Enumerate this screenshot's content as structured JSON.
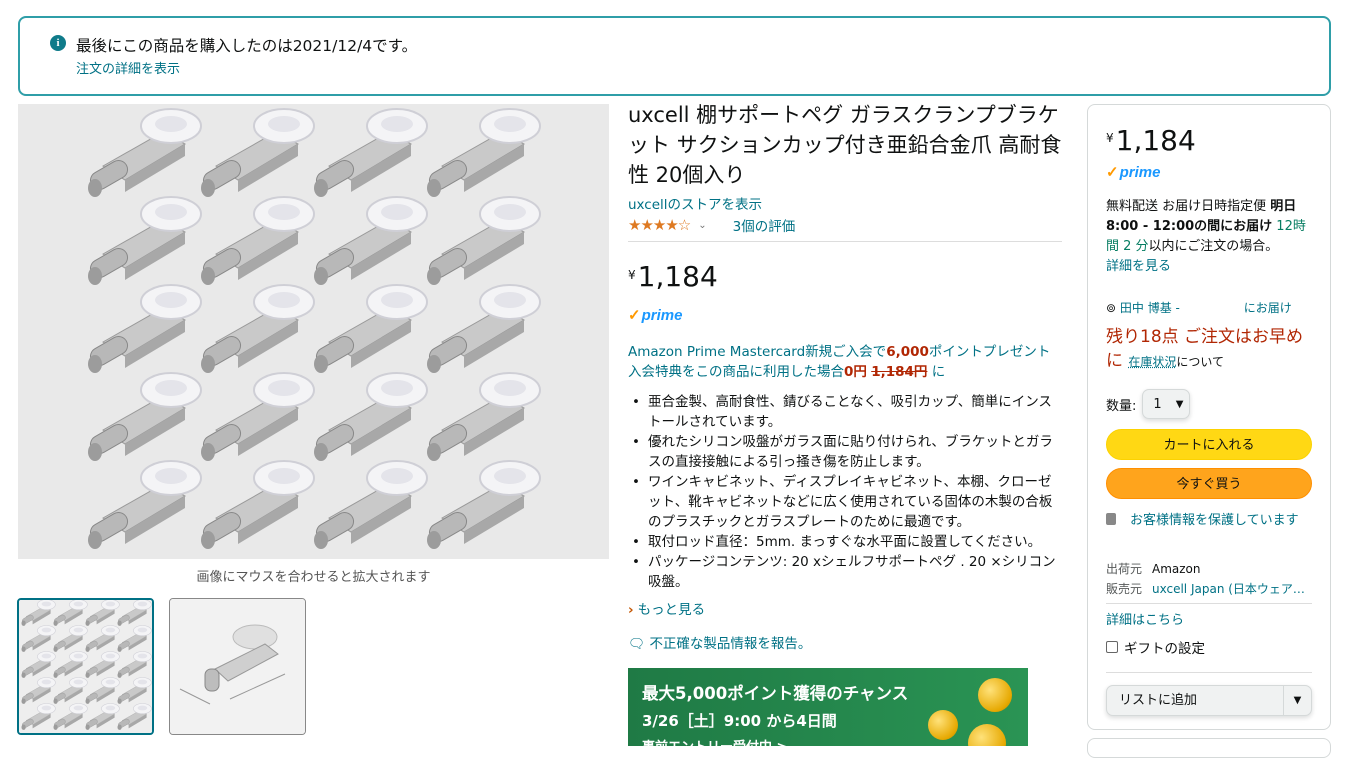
{
  "notice": {
    "icon": "info-icon",
    "message": "最後にこの商品を購入したのは2021/12/4です。",
    "link": "注文の詳細を表示"
  },
  "gallery": {
    "hint": "画像にマウスを合わせると拡大されます",
    "thumbnails": [
      "product-grid-thumbnail",
      "product-dimension-thumbnail"
    ]
  },
  "product": {
    "title": "uxcell 棚サポートペグ ガラスクランプブラケット サクションカップ付き亜鉛合金爪 高耐食性 20個入り",
    "store_link": "uxcellのストアを表示",
    "rating_stars": "★★★★☆",
    "rating_value": 4.5,
    "rating_count": "3個の評価",
    "price_symbol": "¥",
    "price": "1,184",
    "prime": "prime",
    "promo": {
      "text1": "Amazon Prime Mastercard新規ご入会で",
      "points": "6,000",
      "text2": "ポイントプレゼント 入会特典をこの商品に利用した場合",
      "zero": "0円",
      "old": "1,184円",
      "text3": " に"
    },
    "bullets": [
      "亜合金製、高耐食性、錆びることなく、吸引カップ、簡単にインストールされています。",
      "優れたシリコン吸盤がガラス面に貼り付けられ、ブラケットとガラスの直接接触による引っ掻き傷を防止します。",
      "ワインキャビネット、ディスプレイキャビネット、本棚、クローゼット、靴キャビネットなどに広く使用されている固体の木製の合板のプラスチックとガラスプレートのために最適です。",
      "取付ロッド直径：5mm. まっすぐな水平面に設置してください。",
      "パッケージコンテンツ: 20 xシェルフサポートペグ . 20 ×シリコン吸盤。"
    ],
    "see_more": "もっと見る",
    "report": "不正確な製品情報を報告。"
  },
  "banner": {
    "line1": "最大5,000ポイント獲得のチャンス",
    "line2": "3/26［土］9:00 から4日間",
    "line3": "事前エントリー受付中 >"
  },
  "buybox": {
    "price_symbol": "¥",
    "price": "1,184",
    "prime": "prime",
    "delivery_a": "無料配送 お届け日時指定便 ",
    "delivery_b": "明日 8:00 - 12:00の間にお届け",
    "delivery_c": " 12時間 2 分",
    "delivery_d": "以内にご注文の場合。",
    "details_link": "詳細を見る",
    "location_name": "田中 博基 -",
    "location_suffix": "にお届け",
    "stock": "残り18点 ご注文はお早めに",
    "stock_link": "在庫状況",
    "stock_tail": "について",
    "qty_label": "数量:",
    "qty_value": "1",
    "add_to_cart": "カートに入れる",
    "buy_now": "今すぐ買う",
    "secure": "お客様情報を保護しています",
    "ships_from_label": "出荷元",
    "ships_from": "Amazon",
    "sold_by_label": "販売元",
    "sold_by": "uxcell Japan (日本ウェア…",
    "more_details": "詳細はこちら",
    "gift": "ギフトの設定",
    "add_to_list": "リストに追加"
  },
  "colors": {
    "link": "#007185",
    "cart_button": "#ffd814",
    "buy_button": "#ffa41c",
    "price_red": "#b12704",
    "notice_border": "#2f9ea8"
  }
}
